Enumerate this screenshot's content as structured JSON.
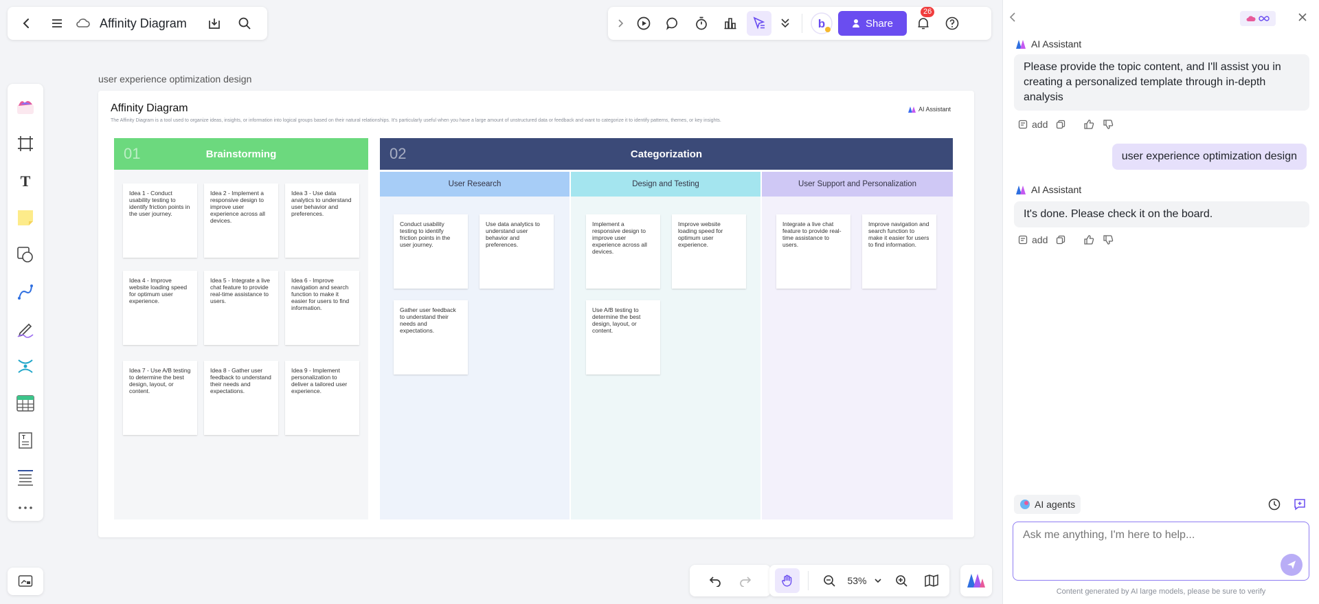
{
  "toolbar": {
    "doc_title": "Affinity Diagram",
    "share_label": "Share",
    "notifications_count": "26"
  },
  "canvas": {
    "frame_label": "user experience optimization design",
    "title": "Affinity Diagram",
    "description": "The Affinity Diagram is a tool used to organize ideas, insights, or information into logical groups based on their natural relationships. It’s particularly useful when you have a large amount of unstructured data or feedback and want to categorize it to identify patterns, themes, or key insights.",
    "logo_text": "AI Assistant",
    "brainstorm": {
      "number": "01",
      "title": "Brainstorming",
      "ideas": [
        "Idea 1 - Conduct usability testing to identify friction points in the user journey.",
        "Idea 2 - Implement a responsive design to improve user experience across all devices.",
        "Idea 3 - Use data analytics to understand user behavior and preferences.",
        "Idea 4 - Improve website loading speed for optimum user experience.",
        "Idea 5 - Integrate a live chat feature to provide real-time assistance to users.",
        "Idea 6 - Improve navigation and search function to make it easier for users to find information.",
        "Idea 7 - Use A/B testing to determine the best design, layout, or content.",
        "Idea 8 - Gather user feedback to understand their needs and expectations.",
        "Idea 9 - Implement personalization to deliver a tailored user experience."
      ]
    },
    "categorization": {
      "number": "02",
      "title": "Categorization",
      "groups": [
        {
          "title": "User Research",
          "notes": [
            "Conduct usability testing to identify friction points in the user journey.",
            "Use data analytics to understand user behavior and preferences.",
            "Gather user feedback to understand their needs and expectations."
          ]
        },
        {
          "title": "Design and Testing",
          "notes": [
            "Implement a responsive design to improve user experience across all devices.",
            "Improve website loading speed for optimum user experience.",
            "Use A/B testing to determine the best design, layout, or content."
          ]
        },
        {
          "title": "User Support and Personalization",
          "notes": [
            "Integrate a live chat feature to provide real-time assistance to users.",
            "Improve navigation and search function to make it easier for users to find information."
          ]
        }
      ]
    }
  },
  "zoom": {
    "level": "53%"
  },
  "ai_panel": {
    "assistant_name": "AI Assistant",
    "messages": [
      {
        "role": "assistant",
        "text": "Please provide the topic content, and I'll assist you in creating a personalized template through in-depth analysis"
      },
      {
        "role": "user",
        "text": "user experience optimization design"
      },
      {
        "role": "assistant",
        "text": "It's done. Please check it on the board."
      }
    ],
    "add_label": "add",
    "agents_label": "AI agents",
    "input_placeholder": "Ask me anything, I'm here to help...",
    "footer": "Content generated by AI large models, please be sure to verify"
  },
  "colors": {
    "brainstorm_header": "#6cd97e",
    "categorization_header": "#3b4a78",
    "user_research": "#a7cdf7",
    "design_testing": "#a4e5ef",
    "user_support": "#cfc8f5",
    "accent": "#6a4df0"
  }
}
